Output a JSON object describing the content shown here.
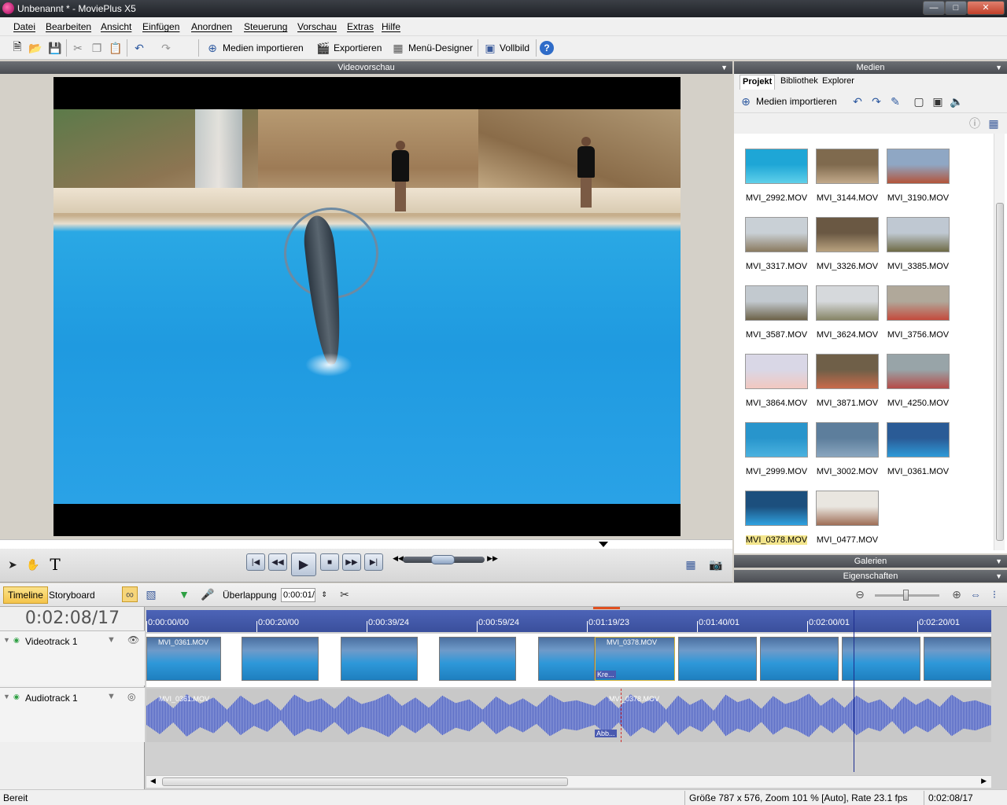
{
  "window": {
    "title": "Unbenannt * - MoviePlus X5",
    "controls": {
      "minimize": "—",
      "maximize": "□",
      "close": "✕"
    }
  },
  "menu": {
    "items": [
      "Datei",
      "Bearbeiten",
      "Ansicht",
      "Einfügen",
      "Anordnen",
      "Steuerung",
      "Vorschau",
      "Extras",
      "Hilfe"
    ]
  },
  "toolbar": {
    "import_label": "Medien importieren",
    "export_label": "Exportieren",
    "menu_designer_label": "Menü-Designer",
    "fullscreen_label": "Vollbild"
  },
  "preview": {
    "header": "Videovorschau"
  },
  "media": {
    "header": "Medien",
    "tabs": [
      "Projekt",
      "Bibliothek",
      "Explorer"
    ],
    "active_tab": "Projekt",
    "import_label": "Medien importieren",
    "items": [
      {
        "name": "MVI_2992.MOV",
        "c1": "#1ea6d6",
        "c2": "#5fd0ea"
      },
      {
        "name": "MVI_3144.MOV",
        "c1": "#7f6a4e",
        "c2": "#c2a98a"
      },
      {
        "name": "MVI_3190.MOV",
        "c1": "#8fa7c4",
        "c2": "#b3543a"
      },
      {
        "name": "MVI_3317.MOV",
        "c1": "#c9d0d6",
        "c2": "#8a7a60"
      },
      {
        "name": "MVI_3326.MOV",
        "c1": "#6a5843",
        "c2": "#b9a27f"
      },
      {
        "name": "MVI_3385.MOV",
        "c1": "#bfc8d2",
        "c2": "#6e6a45"
      },
      {
        "name": "MVI_3587.MOV",
        "c1": "#c2c9cf",
        "c2": "#6c6248"
      },
      {
        "name": "MVI_3624.MOV",
        "c1": "#d6d9dc",
        "c2": "#868466"
      },
      {
        "name": "MVI_3756.MOV",
        "c1": "#b0a89a",
        "c2": "#c44a3c"
      },
      {
        "name": "MVI_3864.MOV",
        "c1": "#d9d7e6",
        "c2": "#f2c8c0"
      },
      {
        "name": "MVI_3871.MOV",
        "c1": "#6f5f48",
        "c2": "#c96a4a"
      },
      {
        "name": "MVI_4250.MOV",
        "c1": "#98a4a8",
        "c2": "#b64b48"
      },
      {
        "name": "MVI_2999.MOV",
        "c1": "#2895cc",
        "c2": "#4bb2df"
      },
      {
        "name": "MVI_3002.MOV",
        "c1": "#5d7e9c",
        "c2": "#8aa6bf"
      },
      {
        "name": "MVI_0361.MOV",
        "c1": "#2a5b96",
        "c2": "#2e9ad8"
      },
      {
        "name": "MVI_0378.MOV",
        "c1": "#1c4f7d",
        "c2": "#2fa2e0"
      },
      {
        "name": "MVI_0477.MOV",
        "c1": "#e9e6e0",
        "c2": "#9e6e56"
      }
    ],
    "selected": "MVI_0378.MOV"
  },
  "panels": {
    "galleries": "Galerien",
    "properties": "Eigenschaften"
  },
  "timeline": {
    "tabs": {
      "timeline": "Timeline",
      "storyboard": "Storyboard"
    },
    "overlap_label": "Überlappung",
    "overlap_value": "0:00:01/",
    "timecode": "0:02:08/17",
    "ruler": [
      "0:00:00/00",
      "0:00:20/00",
      "0:00:39/24",
      "0:00:59/24",
      "0:01:19/23",
      "0:01:40/01",
      "0:02:00/01",
      "0:02:20/01"
    ],
    "tracks": {
      "video": "Videotrack 1",
      "audio": "Audiotrack 1"
    },
    "clips": {
      "first": "MVI_0361.MOV",
      "second": "MVI_0378.MOV"
    },
    "transition_video": "Kre...",
    "transition_audio": "Abb..."
  },
  "status": {
    "ready": "Bereit",
    "info": "Größe 787 x 576, Zoom 101 % [Auto], Rate 23.1 fps",
    "time": "0:02:08/17"
  }
}
